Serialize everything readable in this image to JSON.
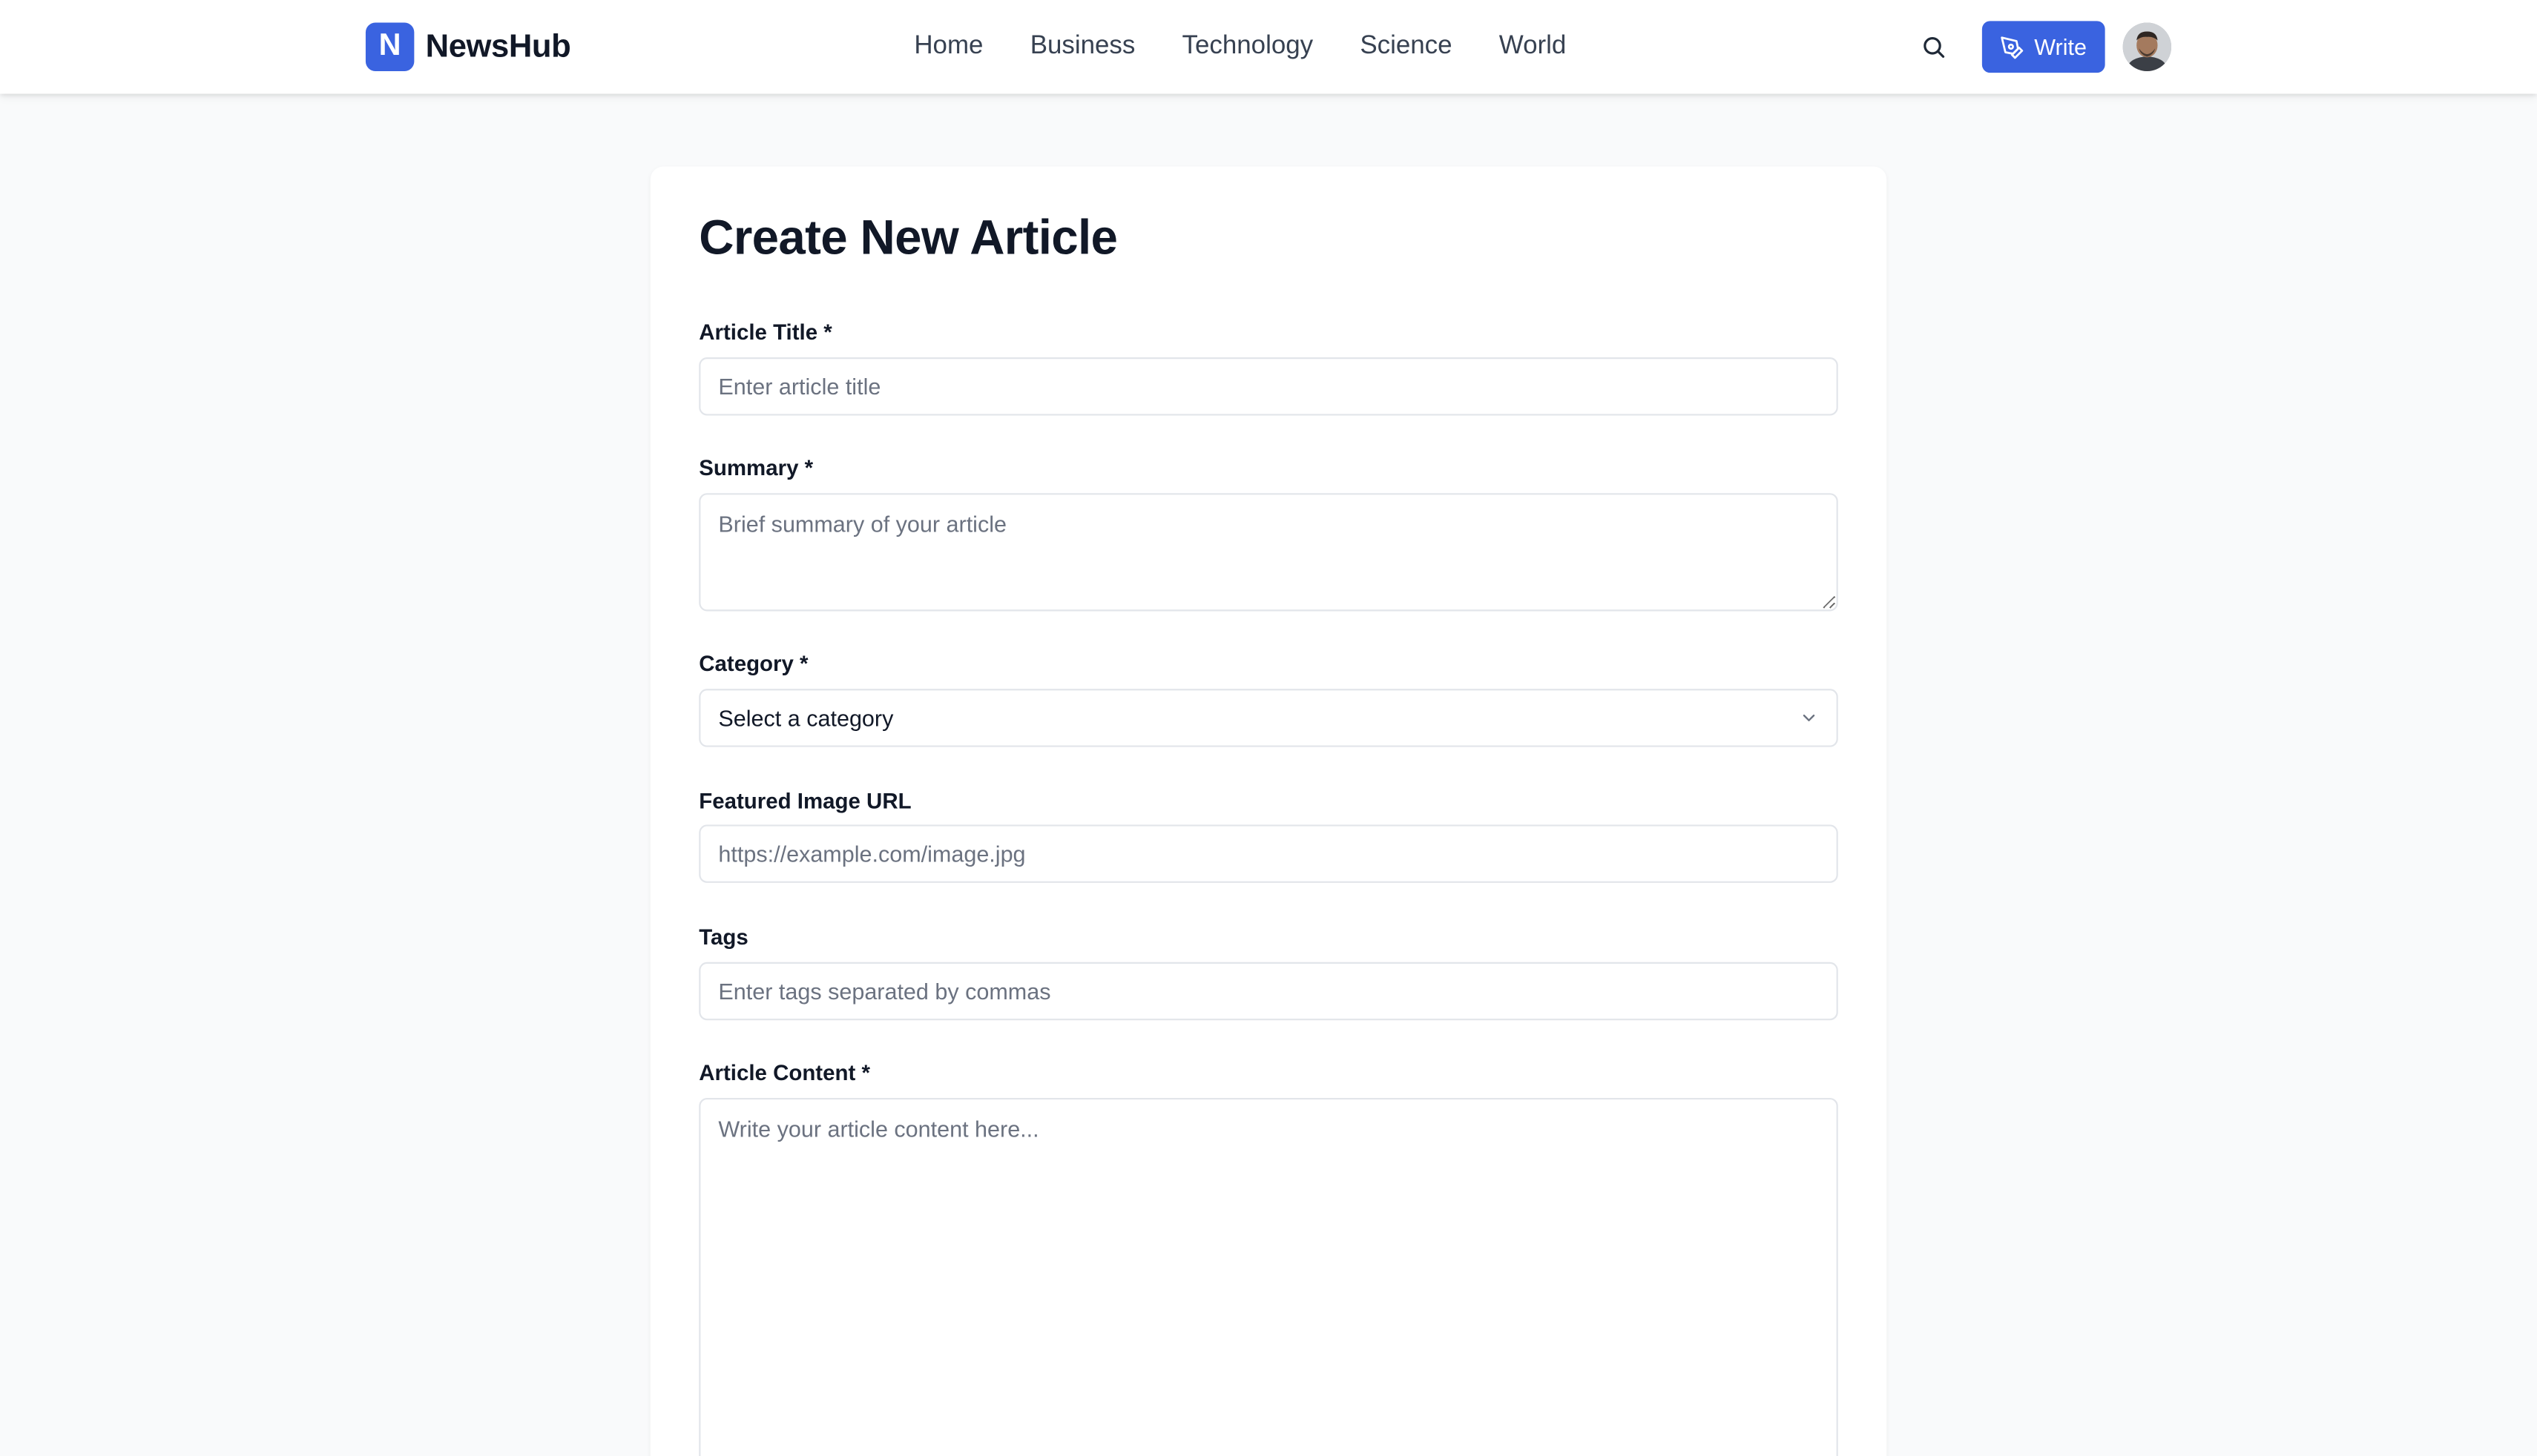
{
  "brand": {
    "mark": "N",
    "name": "NewsHub",
    "accent": "#3a63e0"
  },
  "nav": {
    "items": [
      "Home",
      "Business",
      "Technology",
      "Science",
      "World"
    ]
  },
  "header": {
    "search_icon": "search-icon",
    "write_label": "Write",
    "write_icon": "pen-tool-icon",
    "avatar_icon": "user-avatar"
  },
  "form": {
    "title": "Create New Article",
    "fields": {
      "title": {
        "label": "Article Title *",
        "placeholder": "Enter article title",
        "value": ""
      },
      "summary": {
        "label": "Summary *",
        "placeholder": "Brief summary of your article",
        "value": ""
      },
      "category": {
        "label": "Category *",
        "selected": "Select a category",
        "icon": "chevron-down-icon"
      },
      "image_url": {
        "label": "Featured Image URL",
        "placeholder": "https://example.com/image.jpg",
        "value": ""
      },
      "tags": {
        "label": "Tags",
        "placeholder": "Enter tags separated by commas",
        "value": ""
      },
      "content": {
        "label": "Article Content *",
        "placeholder": "Write your article content here...",
        "value": ""
      }
    }
  }
}
